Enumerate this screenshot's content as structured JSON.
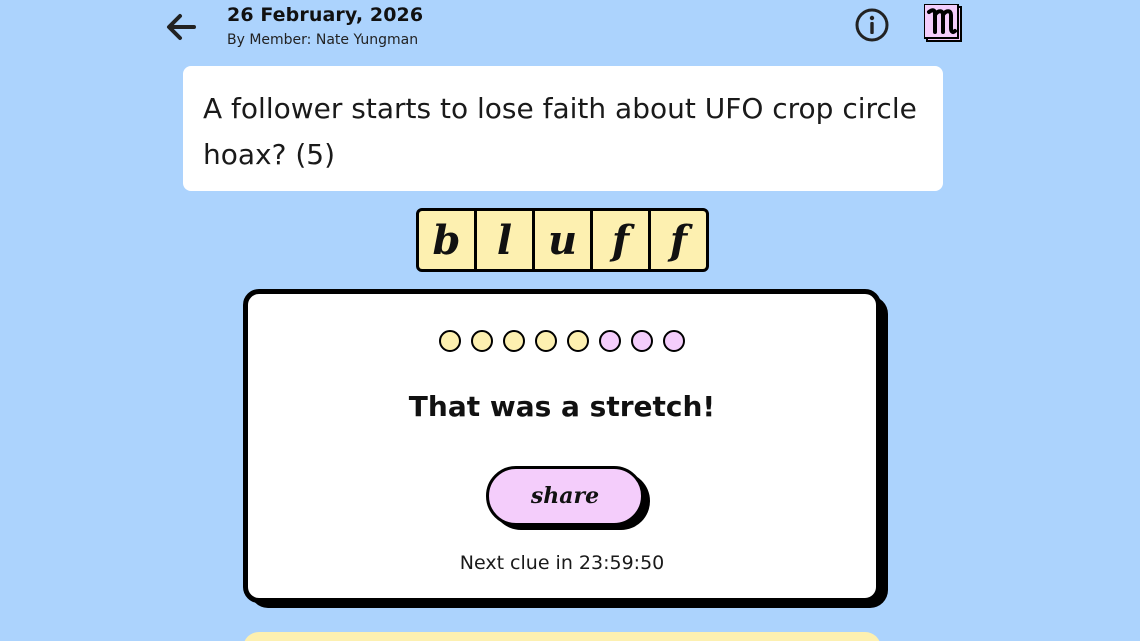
{
  "header": {
    "date": "26 February, 2026",
    "byline": "By Member: Nate Yungman"
  },
  "icons": {
    "back": "arrow-left-icon",
    "info": "info-circle-icon",
    "logo": "m-logo-icon"
  },
  "clue": {
    "text": "A follower starts to lose faith about UFO crop circle hoax? (5)"
  },
  "answer": {
    "letters": [
      "b",
      "l",
      "u",
      "f",
      "f"
    ]
  },
  "result": {
    "dots": [
      {
        "state": "used",
        "color": "#fdf0b0"
      },
      {
        "state": "used",
        "color": "#fdf0b0"
      },
      {
        "state": "used",
        "color": "#fdf0b0"
      },
      {
        "state": "used",
        "color": "#fdf0b0"
      },
      {
        "state": "used",
        "color": "#fdf0b0"
      },
      {
        "state": "remaining",
        "color": "#f4cdfb"
      },
      {
        "state": "remaining",
        "color": "#f4cdfb"
      },
      {
        "state": "remaining",
        "color": "#f4cdfb"
      }
    ],
    "title": "That was a stretch!",
    "share_label": "share",
    "next_clue": "Next clue in 23:59:50"
  },
  "colors": {
    "background": "#acd3fd",
    "tile": "#fdf0b0",
    "accent_pink": "#f4cdfb"
  }
}
